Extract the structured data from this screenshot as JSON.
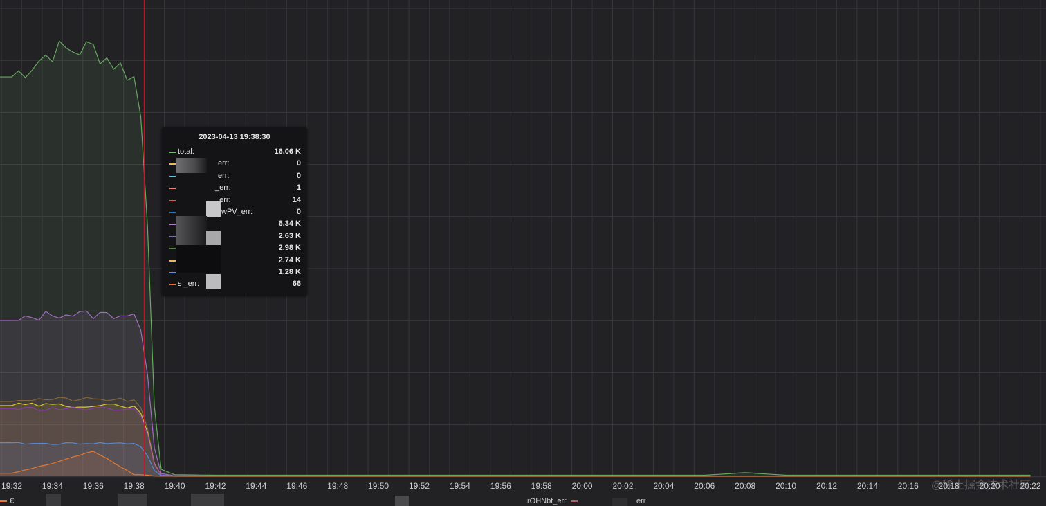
{
  "chart_data": {
    "type": "area",
    "x": [
      "19:32",
      "19:34",
      "19:36",
      "19:38",
      "19:40",
      "19:42",
      "19:44",
      "19:46",
      "19:48",
      "19:50",
      "19:52",
      "19:54",
      "19:56",
      "19:58",
      "20:00",
      "20:02",
      "20:04",
      "20:06",
      "20:08",
      "20:10",
      "20:12",
      "20:14",
      "20:16",
      "20:18",
      "20:20",
      "20:22"
    ],
    "cursor_time": "19:38:30",
    "series": [
      {
        "name": "total",
        "color": "#73bf69",
        "values": [
          15600,
          16600,
          16700,
          15600,
          60,
          40,
          40,
          40,
          40,
          40,
          40,
          40,
          40,
          40,
          40,
          40,
          40,
          40,
          140,
          40,
          40,
          40,
          40,
          40,
          40,
          40
        ]
      },
      {
        "name": "",
        "color": "#b877d9",
        "values": [
          6000,
          6350,
          6300,
          6340,
          20,
          10,
          10,
          10,
          10,
          10,
          10,
          10,
          10,
          10,
          10,
          10,
          10,
          10,
          10,
          10,
          10,
          10,
          10,
          10,
          10,
          10
        ]
      },
      {
        "name": "",
        "color": "#8f6f3f",
        "values": [
          3000,
          3000,
          2990,
          2980,
          10,
          5,
          5,
          5,
          5,
          5,
          5,
          5,
          5,
          5,
          5,
          5,
          5,
          5,
          5,
          5,
          5,
          5,
          5,
          5,
          5,
          5
        ]
      },
      {
        "name": "",
        "color": "#fade2a",
        "values": [
          2780,
          2770,
          2760,
          2740,
          10,
          5,
          5,
          5,
          5,
          5,
          5,
          5,
          5,
          5,
          5,
          5,
          5,
          5,
          5,
          5,
          5,
          5,
          5,
          5,
          5,
          5
        ]
      },
      {
        "name": "",
        "color": "#8f3bb8",
        "values": [
          2640,
          2630,
          2640,
          2630,
          10,
          5,
          5,
          5,
          5,
          5,
          5,
          5,
          5,
          5,
          5,
          5,
          5,
          5,
          5,
          5,
          5,
          5,
          5,
          5,
          5,
          5
        ]
      },
      {
        "name": "",
        "color": "#5794f2",
        "values": [
          1280,
          1270,
          1290,
          1280,
          10,
          5,
          5,
          5,
          5,
          5,
          5,
          5,
          5,
          5,
          5,
          5,
          5,
          5,
          5,
          5,
          5,
          5,
          5,
          5,
          5,
          5
        ]
      },
      {
        "name": "",
        "color": "#ff7f2a",
        "values": [
          120,
          500,
          1000,
          66,
          5,
          2,
          2,
          2,
          2,
          2,
          2,
          2,
          2,
          2,
          2,
          2,
          2,
          2,
          2,
          2,
          2,
          2,
          2,
          2,
          2,
          2
        ]
      }
    ]
  },
  "tooltip": {
    "title": "2023-04-13 19:38:30",
    "rows": [
      {
        "label": "total:",
        "value": "16.06 K",
        "color": "#73bf69"
      },
      {
        "label": "err:",
        "value": "0",
        "color": "#f2b84b"
      },
      {
        "label": "err:",
        "value": "0",
        "color": "#5ec7de"
      },
      {
        "label": "_err:",
        "value": "1",
        "color": "#f2836b"
      },
      {
        "label": "_err:",
        "value": "14",
        "color": "#e0585b"
      },
      {
        "label": "wPV_err:",
        "value": "0",
        "color": "#1f78c1"
      },
      {
        "label": "",
        "value": "6.34 K",
        "color": "#b877d9"
      },
      {
        "label": "r",
        "value": "2.63 K",
        "color": "#806eb7"
      },
      {
        "label": "\"",
        "value": "2.98 K",
        "color": "#508642"
      },
      {
        "label": "",
        "value": "2.74 K",
        "color": "#f2b84b"
      },
      {
        "label": "",
        "value": "1.28 K",
        "color": "#5794f2"
      },
      {
        "label": "s  _err:",
        "value": "66",
        "color": "#f2732b"
      }
    ]
  },
  "legend_strip": {
    "items": [
      {
        "label": "€",
        "color": "#f2732b"
      },
      {
        "label": "rOHNbt_err",
        "color": "#b06060"
      },
      {
        "label": "err",
        "color": "#a06040"
      }
    ]
  },
  "watermark": "@稀土掘金技术社区"
}
